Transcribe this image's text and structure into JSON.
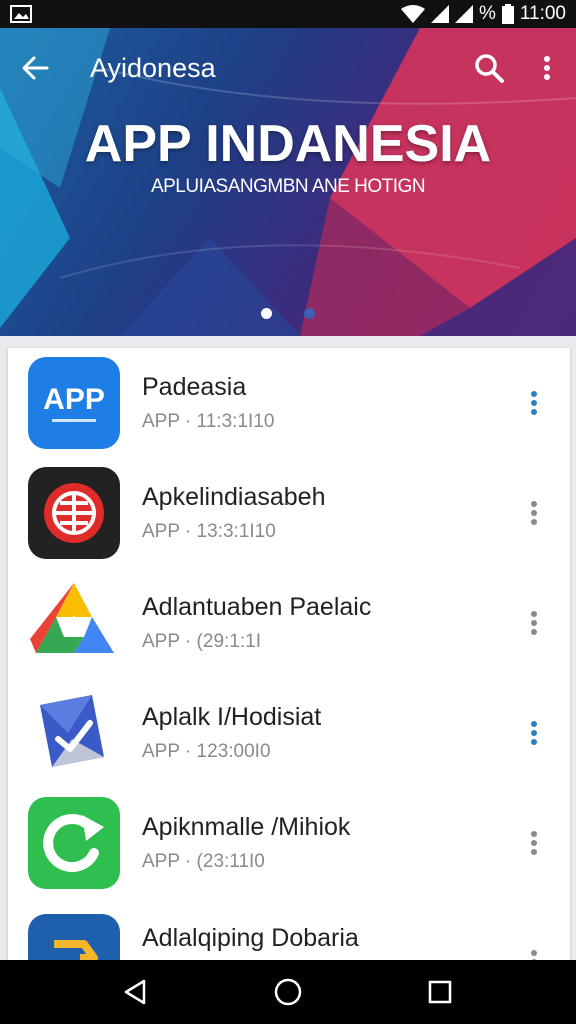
{
  "status_bar": {
    "time": "11:00",
    "battery_label": "%"
  },
  "appbar": {
    "title": "Ayidonesa"
  },
  "banner": {
    "title": "APP INDANESIA",
    "subtitle": "APLUIASANGMBN ANE HOTIGN",
    "pages": 2,
    "active_page": 1
  },
  "apps": [
    {
      "name": "Padeasia",
      "meta": "APP · 11:3:1I10",
      "icon": "app-badge-icon",
      "icon_text": "APP",
      "icon_bg": "#1f7de6",
      "menu_color": "#2a7fc0"
    },
    {
      "name": "Apkelindiasabeh",
      "meta": "APP · 13:3:1I10",
      "icon": "globe-target-icon",
      "icon_bg": "#222222",
      "menu_color": "#8a8a8a"
    },
    {
      "name": "Adlantuaben Paelaic",
      "meta": "APP · (29:1:1I",
      "icon": "tri-color-a-icon",
      "icon_bg": "#ffffff",
      "menu_color": "#8a8a8a"
    },
    {
      "name": "Aplalk I/Hodisiat",
      "meta": "APP · 123:00I0",
      "icon": "check-envelope-icon",
      "icon_bg": "#ffffff",
      "menu_color": "#2a7fc0"
    },
    {
      "name": "Apiknmalle /Mihiok",
      "meta": "APP · (23:11I0",
      "icon": "refresh-icon",
      "icon_bg": "#2fbf4f",
      "menu_color": "#8a8a8a"
    },
    {
      "name": "Adlalqiping Dobaria",
      "meta": "",
      "icon": "arrow-badge-icon",
      "icon_bg": "#1e5fae",
      "menu_color": "#8a8a8a"
    }
  ],
  "colors": {
    "accent": "#2a7fc0",
    "status_bar": "#111111",
    "nav_bar": "#000000"
  }
}
